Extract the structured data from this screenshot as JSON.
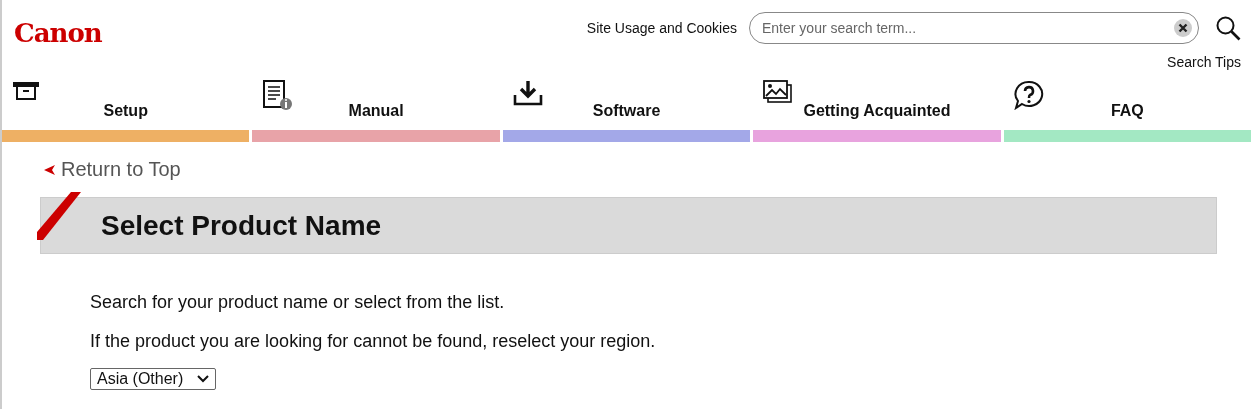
{
  "header": {
    "logo": "Canon",
    "links": [
      "Site Usage and Cookies"
    ],
    "search": {
      "placeholder": "Enter your search term..."
    },
    "search_tips": "Search Tips"
  },
  "nav": [
    {
      "label": "Setup",
      "kind": "box",
      "color": "#eeb064"
    },
    {
      "label": "Manual",
      "kind": "document",
      "color": "#e8a3a8"
    },
    {
      "label": "Software",
      "kind": "download",
      "color": "#a3a8e8"
    },
    {
      "label": "Getting Acquainted",
      "kind": "images",
      "color": "#e8a3de"
    },
    {
      "label": "FAQ",
      "kind": "question",
      "color": "#a3e8c3"
    }
  ],
  "back_link": "Return to Top",
  "heading": "Select Product Name",
  "paragraphs": [
    "Search for your product name or select from the list.",
    "If the product you are looking for cannot be found, reselect your region."
  ],
  "region_select": {
    "value": "Asia (Other)"
  }
}
